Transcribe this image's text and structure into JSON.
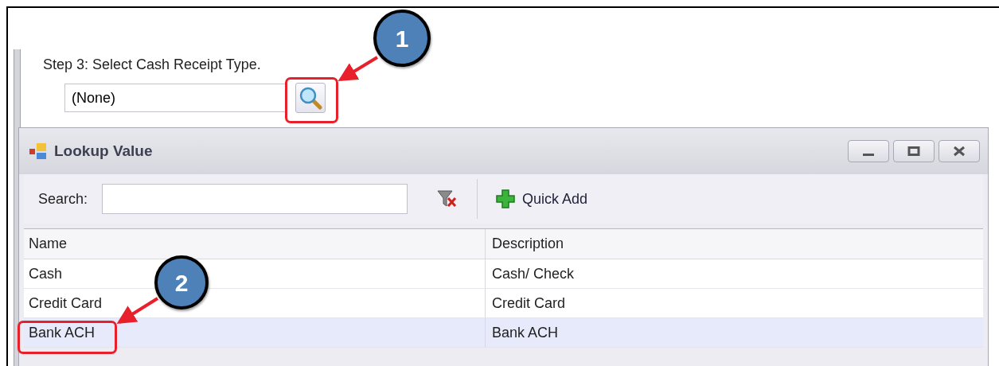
{
  "step_label": "Step 3: Select Cash Receipt Type.",
  "field": {
    "value": "(None)"
  },
  "dialog": {
    "title": "Lookup Value",
    "search_label": "Search:",
    "quick_add": "Quick Add",
    "table": {
      "columns": [
        "Name",
        "Description"
      ],
      "rows": [
        {
          "cells": [
            "Cash",
            "Cash/ Check"
          ],
          "selected": false
        },
        {
          "cells": [
            "Credit Card",
            "Credit Card"
          ],
          "selected": false
        },
        {
          "cells": [
            "Bank ACH",
            "Bank ACH"
          ],
          "selected": true
        }
      ]
    }
  },
  "callouts": [
    {
      "number": "1"
    },
    {
      "number": "2"
    }
  ]
}
